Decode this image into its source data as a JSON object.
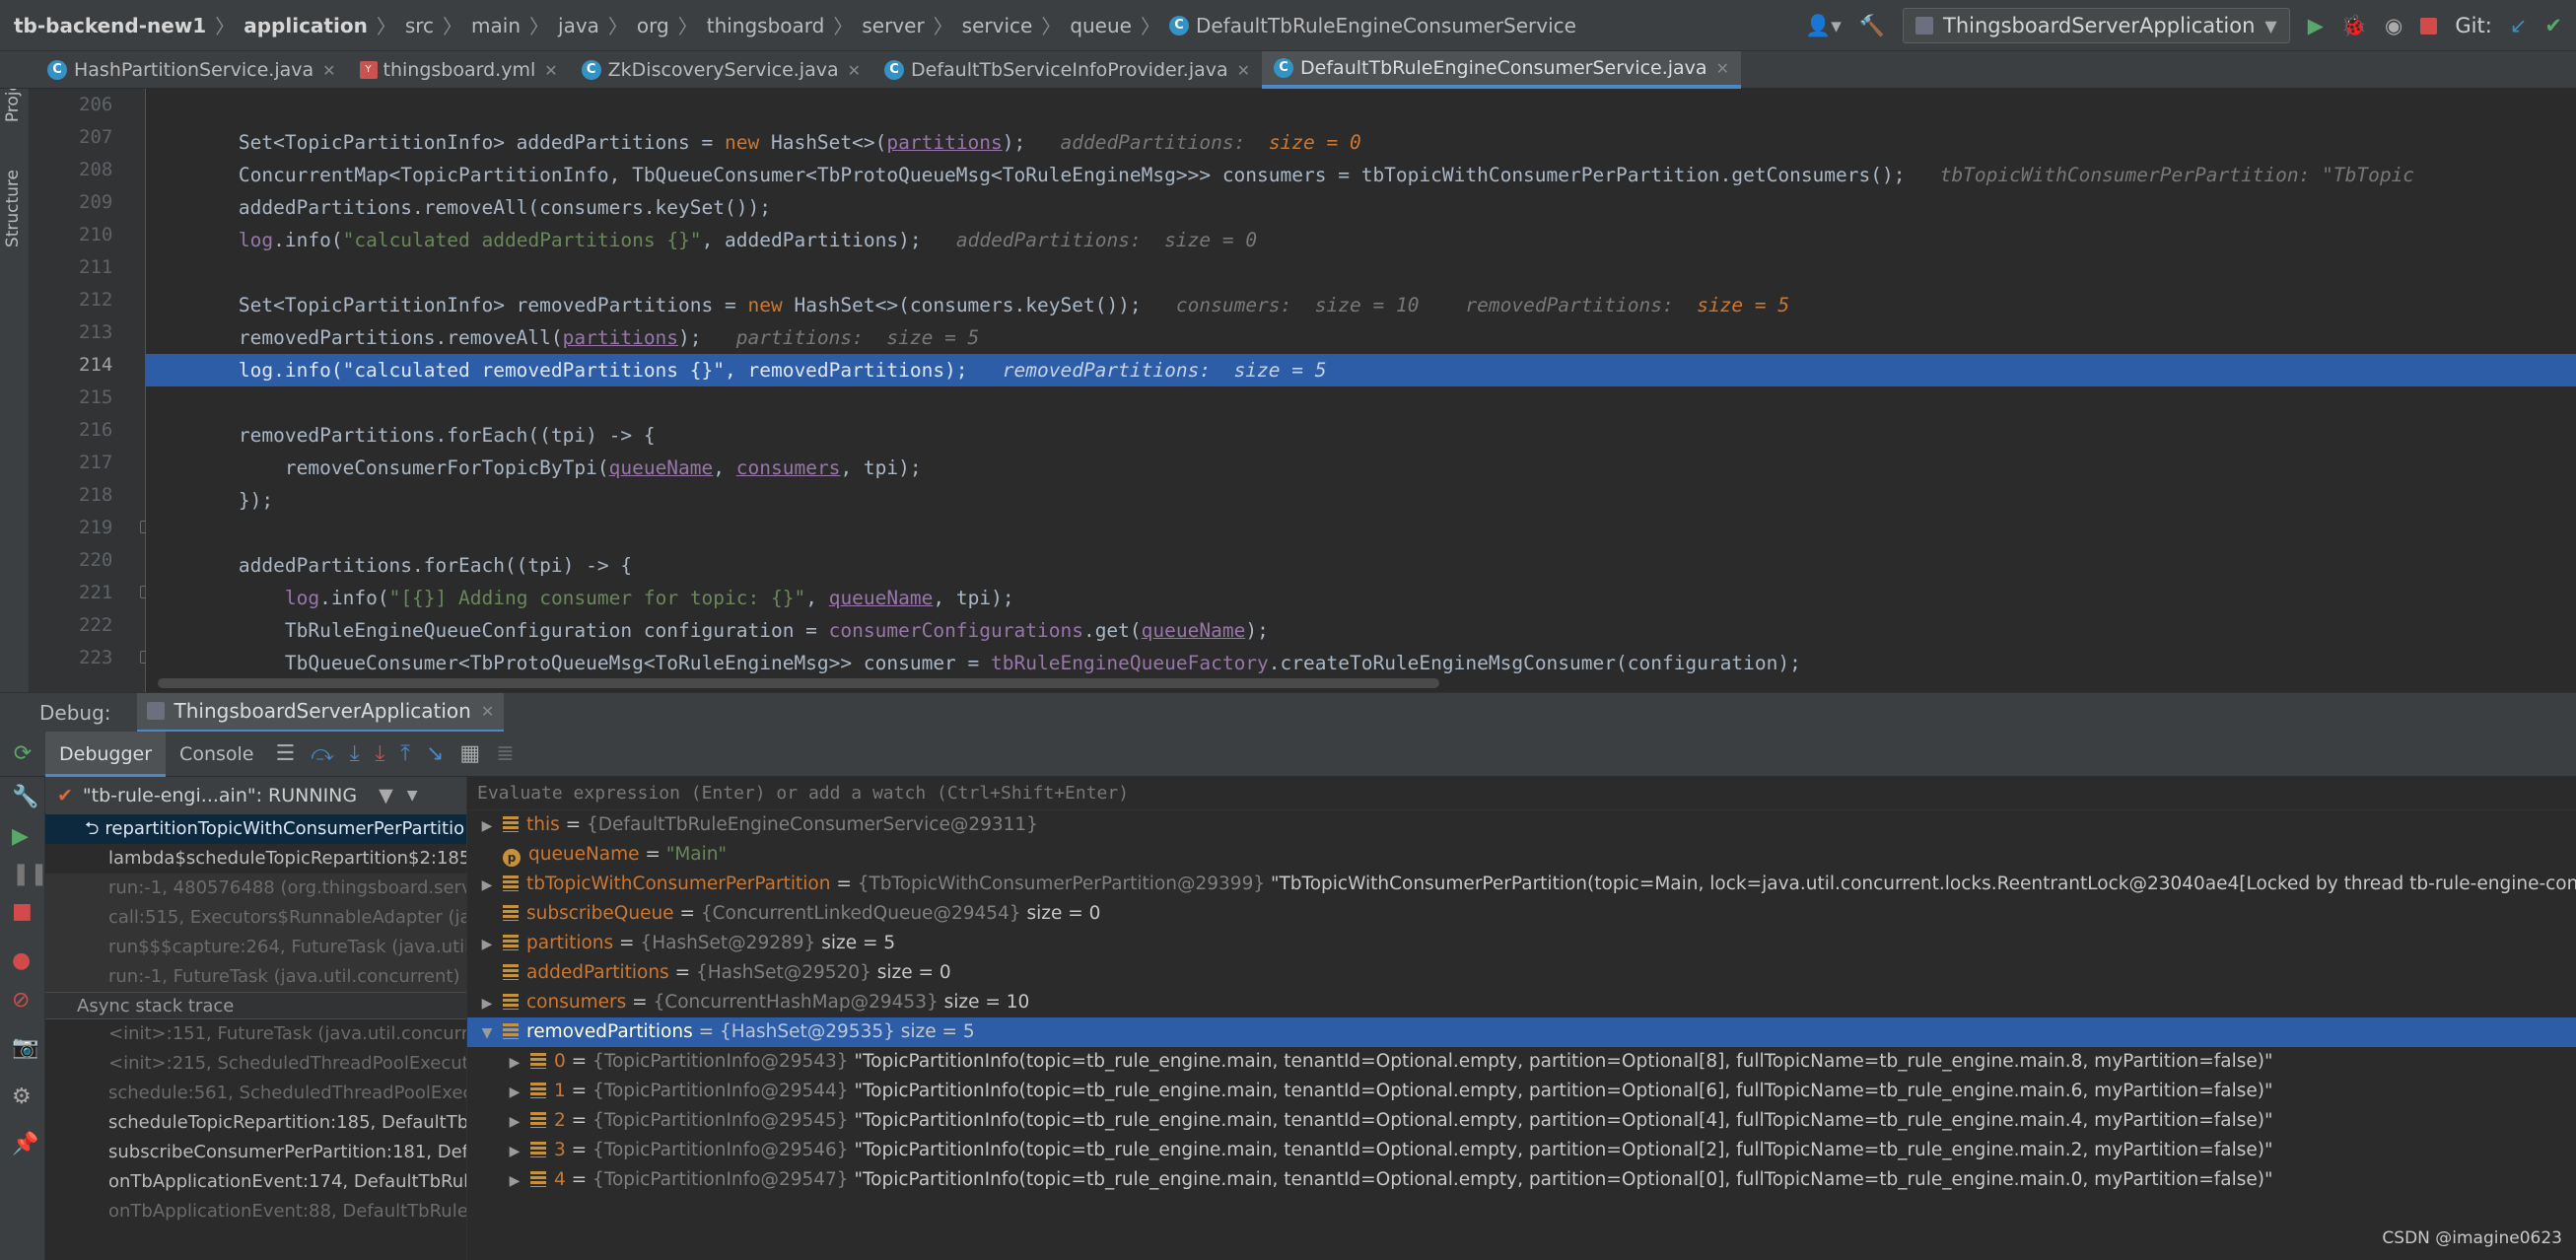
{
  "breadcrumb": [
    "tb-backend-new1",
    "application",
    "src",
    "main",
    "java",
    "org",
    "thingsboard",
    "server",
    "service",
    "queue",
    "DefaultTbRuleEngineConsumerService"
  ],
  "toolbar": {
    "run_config": "ThingsboardServerApplication",
    "git_label": "Git:"
  },
  "tabs": [
    {
      "label": "HashPartitionService.java",
      "icon": "java-class-icon"
    },
    {
      "label": "thingsboard.yml",
      "icon": "yml-icon"
    },
    {
      "label": "ZkDiscoveryService.java",
      "icon": "java-class-icon"
    },
    {
      "label": "DefaultTbServiceInfoProvider.java",
      "icon": "java-class-icon"
    },
    {
      "label": "DefaultTbRuleEngineConsumerService.java",
      "icon": "java-class-icon",
      "active": true
    }
  ],
  "side": {
    "project": "Project",
    "structure": "Structure"
  },
  "code": {
    "line_numbers": [
      "206",
      "207",
      "208",
      "209",
      "210",
      "211",
      "212",
      "213",
      "214",
      "215",
      "216",
      "217",
      "218",
      "219",
      "220",
      "221",
      "222",
      "223"
    ],
    "l207": {
      "a": "        Set<TopicPartitionInfo> addedPartitions = ",
      "kw": "new",
      "b": " HashSet<>(",
      "p": "partitions",
      "c": ");",
      "h1": "   addedPartitions:  ",
      "h2": "size = 0"
    },
    "l208": {
      "a": "        ConcurrentMap<TopicPartitionInfo, TbQueueConsumer<TbProtoQueueMsg<ToRuleEngineMsg>>> consumers = tbTopicWithConsumerPerPartition.getConsumers();",
      "h1": "   tbTopicWithConsumerPerPartition: \"TbTopic"
    },
    "l209": {
      "a": "        addedPartitions.removeAll(consumers.keySet());"
    },
    "l210": {
      "f": "log",
      "a": ".info(",
      "s": "\"calculated addedPartitions {}\"",
      "b": ", addedPartitions);",
      "h1": "   addedPartitions:  size = 0"
    },
    "l212": {
      "a": "        Set<TopicPartitionInfo> removedPartitions = ",
      "kw": "new",
      "b": " HashSet<>(consumers.keySet());",
      "h1": "   consumers:  size = 10    removedPartitions:  ",
      "h2": "size = 5"
    },
    "l213": {
      "a": "        removedPartitions.removeAll(",
      "p": "partitions",
      "b": ");",
      "h1": "   partitions:  size = 5"
    },
    "l214": {
      "a": "        log.info(\"calculated removedPartitions {}\", removedPartitions);",
      "h1": "   removedPartitions:  size = 5"
    },
    "l216": {
      "a": "        removedPartitions.forEach((tpi) -> {"
    },
    "l217": {
      "a": "            removeConsumerForTopicByTpi(",
      "p1": "queueName",
      "b": ", ",
      "p2": "consumers",
      "c": ", tpi);"
    },
    "l218": {
      "a": "        });"
    },
    "l220": {
      "a": "        addedPartitions.forEach((tpi) -> {"
    },
    "l221": {
      "f": "log",
      "a": ".info(",
      "s": "\"[{}] Adding consumer for topic: {}\"",
      "b": ", ",
      "p": "queueName",
      "c": ", tpi);"
    },
    "l222": {
      "a": "            TbRuleEngineQueueConfiguration configuration = ",
      "fl": "consumerConfigurations",
      "b": ".get(",
      "p": "queueName",
      "c": ");"
    },
    "l223": {
      "a": "            TbQueueConsumer<TbProtoQueueMsg<ToRuleEngineMsg>> consumer = ",
      "fl": "tbRuleEngineQueueFactory",
      "b": ".createToRuleEngineMsgConsumer(configuration);"
    }
  },
  "debug": {
    "label": "Debug:",
    "session": "ThingsboardServerApplication",
    "tab_debugger": "Debugger",
    "tab_console": "Console",
    "thread": "\"tb-rule-engi...ain\": RUNNING",
    "frames": [
      {
        "t": "repartitionTopicWithConsumerPerPartitio",
        "k": "sel"
      },
      {
        "t": "lambda$scheduleTopicRepartition$2:185,",
        "k": ""
      },
      {
        "t": "run:-1, 480576488 (org.thingsboard.serv",
        "k": "lib"
      },
      {
        "t": "call:515, Executors$RunnableAdapter (jav",
        "k": "lib"
      },
      {
        "t": "run$$$capture:264, FutureTask (java.util",
        "k": "lib"
      },
      {
        "t": "run:-1, FutureTask (java.util.concurrent)",
        "k": "lib"
      }
    ],
    "async_label": "Async stack trace",
    "async_frames": [
      {
        "t": "<init>:151, FutureTask (java.util.concurren",
        "k": "asyncf"
      },
      {
        "t": "<init>:215, ScheduledThreadPoolExecuto",
        "k": "asyncf"
      },
      {
        "t": "schedule:561, ScheduledThreadPoolExecu",
        "k": "asyncf"
      },
      {
        "t": "scheduleTopicRepartition:185, DefaultTbR",
        "k": ""
      },
      {
        "t": "subscribeConsumerPerPartition:181, Defa",
        "k": ""
      },
      {
        "t": "onTbApplicationEvent:174, DefaultTbRule",
        "k": ""
      },
      {
        "t": "onTbApplicationEvent:88, DefaultTbRuleE",
        "k": "asyncf"
      }
    ],
    "eval_placeholder": "Evaluate expression (Enter) or add a watch (Ctrl+Shift+Enter)",
    "vars": [
      {
        "name": "this",
        "ref": "{DefaultTbRuleEngineConsumerService@29311}",
        "val": "",
        "icon": "field",
        "open": false,
        "sub": false
      },
      {
        "name": "queueName",
        "ref": "",
        "val": "\"Main\"",
        "icon": "param",
        "open": null,
        "sub": false
      },
      {
        "name": "tbTopicWithConsumerPerPartition",
        "ref": "{TbTopicWithConsumerPerPartition@29399}",
        "val": "\"TbTopicWithConsumerPerPartition(topic=Main, lock=java.util.concurrent.locks.ReentrantLock@23040ae4[Locked by thread tb-rule-engine-consumer-repart",
        "icon": "field",
        "open": false,
        "sub": false
      },
      {
        "name": "subscribeQueue",
        "ref": "{ConcurrentLinkedQueue@29454}",
        "val": "size = 0",
        "icon": "field",
        "open": null,
        "sub": false
      },
      {
        "name": "partitions",
        "ref": "{HashSet@29289}",
        "val": "size = 5",
        "icon": "field",
        "open": false,
        "sub": false
      },
      {
        "name": "addedPartitions",
        "ref": "{HashSet@29520}",
        "val": "size = 0",
        "icon": "field",
        "open": null,
        "sub": false
      },
      {
        "name": "consumers",
        "ref": "{ConcurrentHashMap@29453}",
        "val": "size = 10",
        "icon": "field",
        "open": false,
        "sub": false
      },
      {
        "name": "removedPartitions",
        "ref": "{HashSet@29535}",
        "val": "size = 5",
        "icon": "field",
        "open": true,
        "sub": false,
        "sel": true
      },
      {
        "name": "0",
        "ref": "{TopicPartitionInfo@29543}",
        "val": "\"TopicPartitionInfo(topic=tb_rule_engine.main, tenantId=Optional.empty, partition=Optional[8], fullTopicName=tb_rule_engine.main.8, myPartition=false)\"",
        "icon": "field",
        "open": false,
        "sub": true
      },
      {
        "name": "1",
        "ref": "{TopicPartitionInfo@29544}",
        "val": "\"TopicPartitionInfo(topic=tb_rule_engine.main, tenantId=Optional.empty, partition=Optional[6], fullTopicName=tb_rule_engine.main.6, myPartition=false)\"",
        "icon": "field",
        "open": false,
        "sub": true
      },
      {
        "name": "2",
        "ref": "{TopicPartitionInfo@29545}",
        "val": "\"TopicPartitionInfo(topic=tb_rule_engine.main, tenantId=Optional.empty, partition=Optional[4], fullTopicName=tb_rule_engine.main.4, myPartition=false)\"",
        "icon": "field",
        "open": false,
        "sub": true
      },
      {
        "name": "3",
        "ref": "{TopicPartitionInfo@29546}",
        "val": "\"TopicPartitionInfo(topic=tb_rule_engine.main, tenantId=Optional.empty, partition=Optional[2], fullTopicName=tb_rule_engine.main.2, myPartition=false)\"",
        "icon": "field",
        "open": false,
        "sub": true
      },
      {
        "name": "4",
        "ref": "{TopicPartitionInfo@29547}",
        "val": "\"TopicPartitionInfo(topic=tb_rule_engine.main, tenantId=Optional.empty, partition=Optional[0], fullTopicName=tb_rule_engine.main.0, myPartition=false)\"",
        "icon": "field",
        "open": false,
        "sub": true
      }
    ]
  },
  "watermark": "CSDN @imagine0623"
}
